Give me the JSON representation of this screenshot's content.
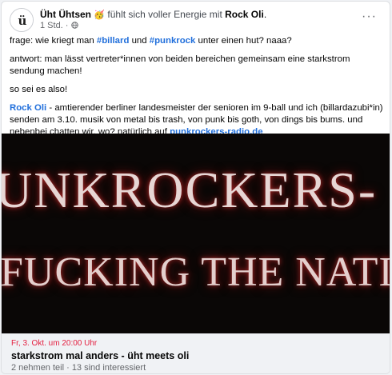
{
  "post": {
    "author": "Üht Ühtsen",
    "emoji": "🥳",
    "feeling": "fühlt sich voller Energie mit",
    "with": "Rock Oli",
    "period": ".",
    "time": "1 Std.",
    "dot": " · ",
    "privacy_icon": "globe-icon",
    "avatar_letter": "ü",
    "more_icon": "ellipsis-icon",
    "more_glyph": "···"
  },
  "body": {
    "p1_a": "frage: wie kriegt man ",
    "p1_tag1": "#billard",
    "p1_b": " und ",
    "p1_tag2": "#punkrock",
    "p1_c": " unter einen hut? naaa?",
    "p2": "antwort: man lässt vertreter*innen von beiden bereichen gemeinsam eine starkstrom sendung machen!",
    "p3": "so sei es also!",
    "p4_mention": "Rock Oli",
    "p4_text": " - amtierender berliner landesmeister der senioren im 9-ball und ich (billardazubi*in) senden am 3.10. musik von metal bis trash, von punk bis goth, von dings bis bums. und nebenbei chatten wir. wo? natürlich auf ",
    "p4_link": "punkrockers-radio.de"
  },
  "banner": {
    "line1": "UNKROCKERS-",
    "line2": "FUCKING THE NATION I"
  },
  "event": {
    "date": "Fr, 3. Okt. um 20:00 Uhr",
    "title": "starkstrom mal anders - üht meets oli",
    "stats": "2 nehmen teil · 13 sind interessiert"
  },
  "colors": {
    "link": "#216fdb",
    "date_red": "#e41e3f",
    "muted": "#65676b"
  }
}
